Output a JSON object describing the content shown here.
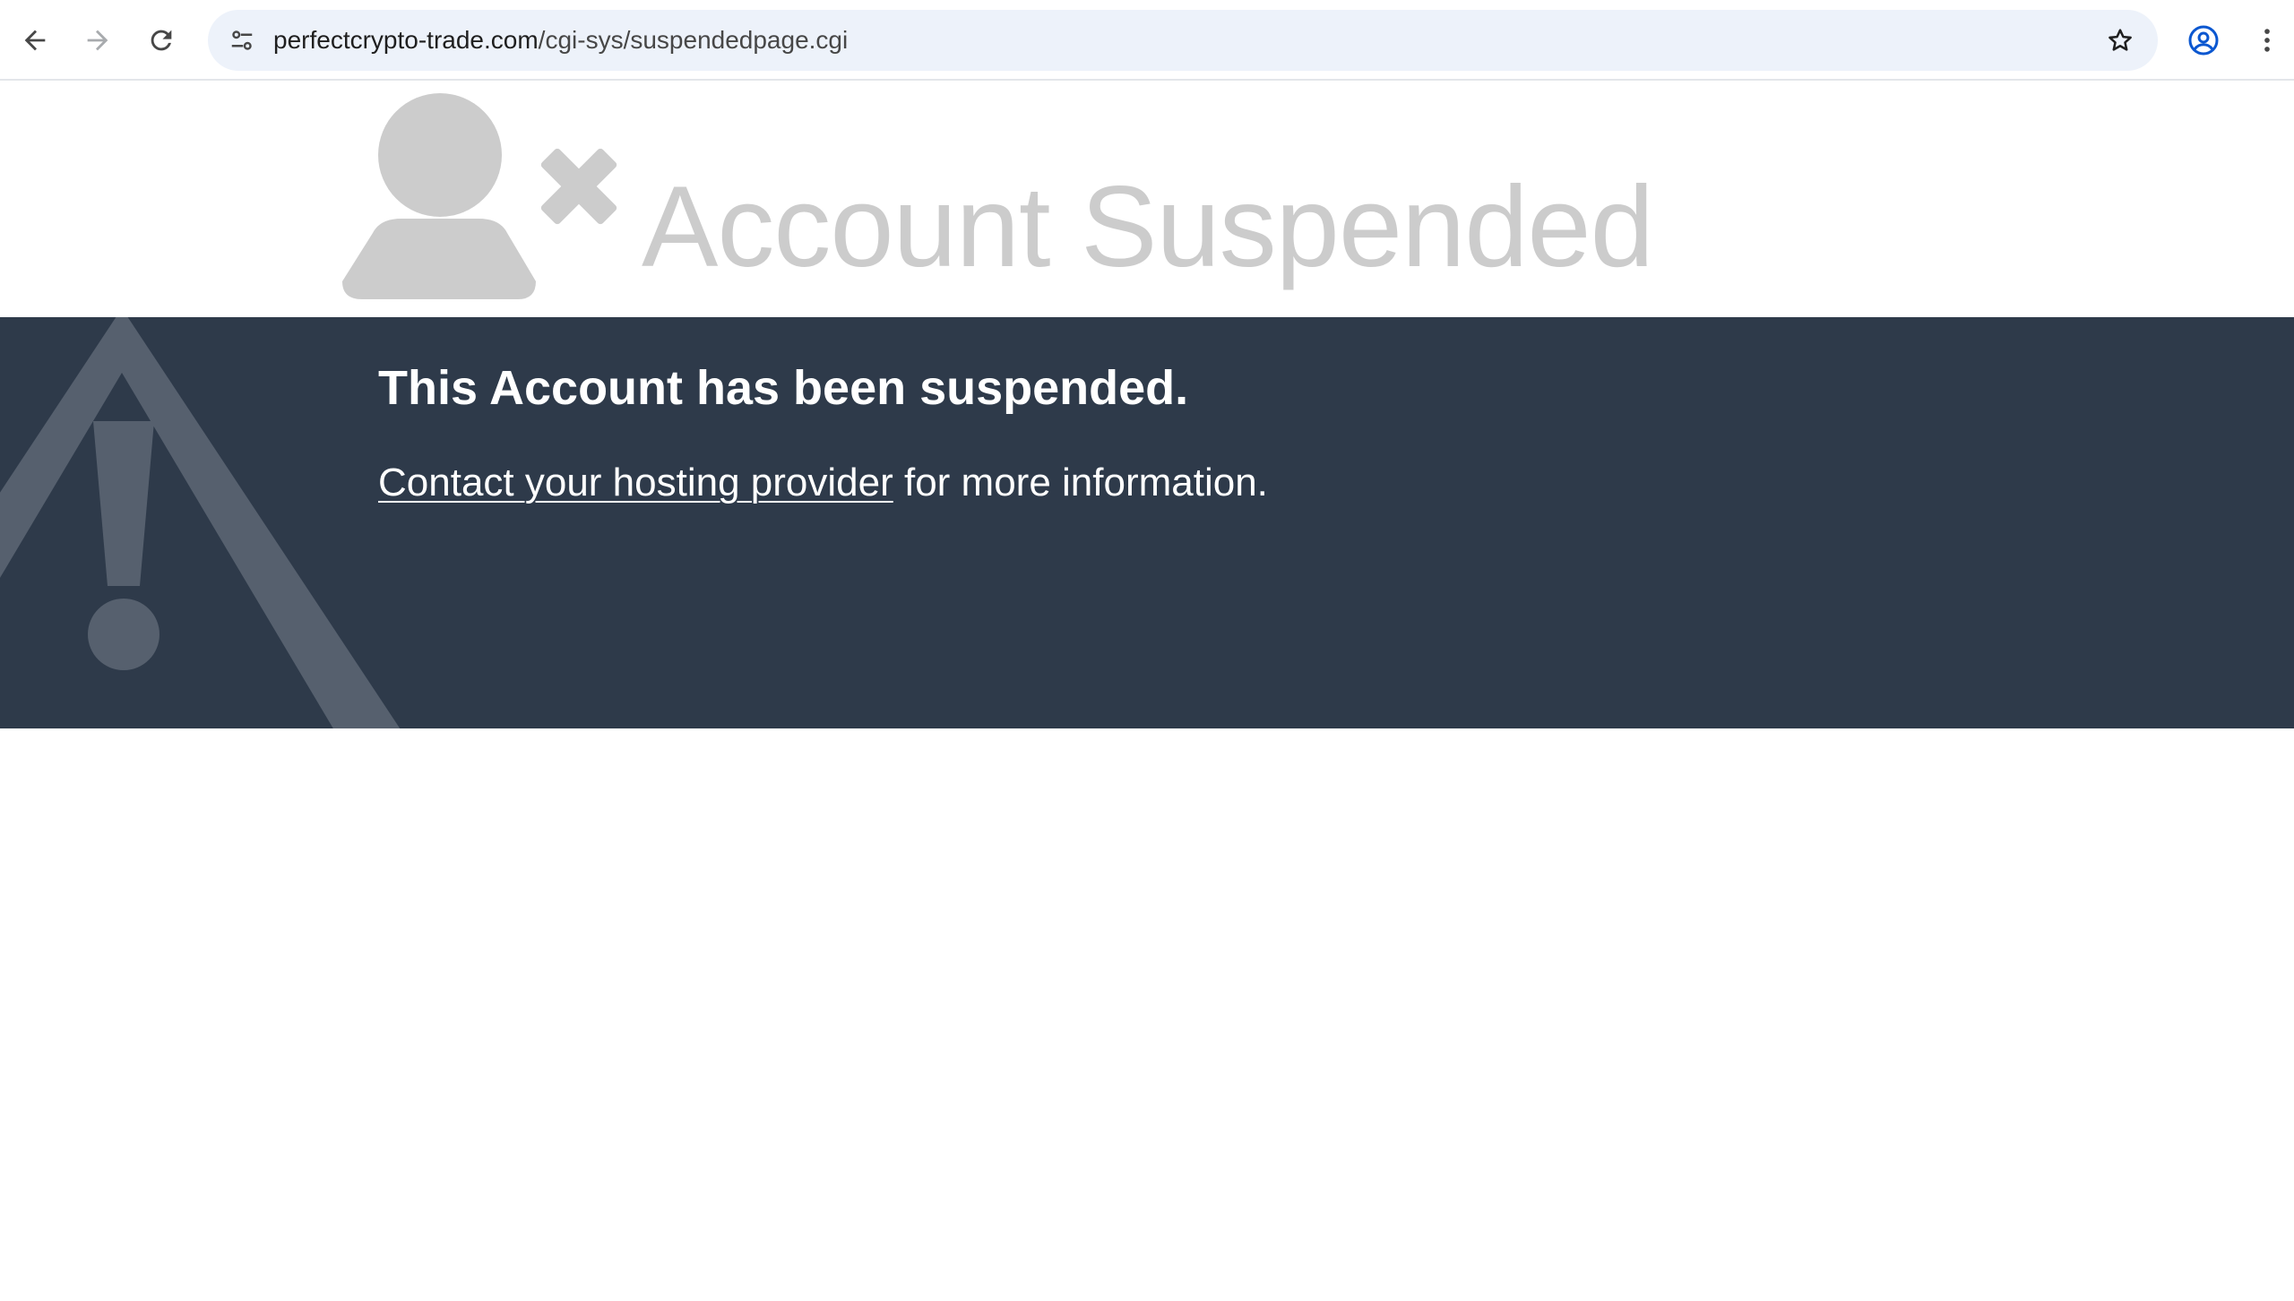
{
  "browser": {
    "url_host": "perfectcrypto-trade.com",
    "url_path": "/cgi-sys/suspendedpage.cgi",
    "icons": {
      "back": "back-arrow-icon",
      "forward": "forward-arrow-icon",
      "reload": "reload-icon",
      "site_info": "tune-icon",
      "bookmark": "star-icon",
      "profile": "account-circle-icon",
      "menu": "more-vert-icon"
    },
    "colors": {
      "omnibox_bg": "#edf2fa",
      "profile_accent": "#0b57d0"
    }
  },
  "page": {
    "title": "Account Suspended",
    "heading": "This Account has been suspended.",
    "contact_link": "Contact your hosting provider",
    "contact_suffix": " for more information.",
    "icons": {
      "header": "user-suspended-icon",
      "banner": "warning-triangle-icon"
    },
    "colors": {
      "title": "#cccccc",
      "banner_bg": "#2e3a4a",
      "banner_text": "#ffffff",
      "icon_gray": "#cccccc",
      "warning_icon": "#56606e"
    }
  }
}
